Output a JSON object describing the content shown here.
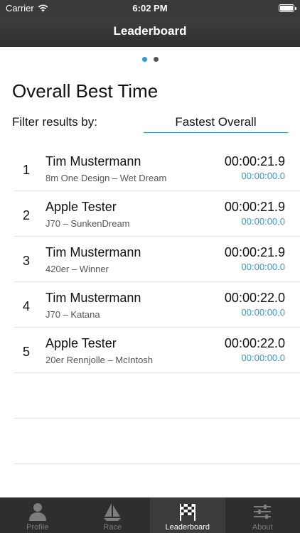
{
  "status": {
    "carrier": "Carrier",
    "time": "6:02 PM"
  },
  "nav": {
    "title": "Leaderboard"
  },
  "page": {
    "title": "Overall Best Time",
    "filter_label": "Filter results by:",
    "filter_value": "Fastest Overall"
  },
  "results": [
    {
      "rank": "1",
      "name": "Tim Mustermann",
      "boat": "8m One Design – Wet Dream",
      "time": "00:00:21.9",
      "sub": "00:00:00.0"
    },
    {
      "rank": "2",
      "name": "Apple Tester",
      "boat": "J70 – SunkenDream",
      "time": "00:00:21.9",
      "sub": "00:00:00.0"
    },
    {
      "rank": "3",
      "name": "Tim Mustermann",
      "boat": "420er – Winner",
      "time": "00:00:21.9",
      "sub": "00:00:00.0"
    },
    {
      "rank": "4",
      "name": "Tim Mustermann",
      "boat": "J70 – Katana",
      "time": "00:00:22.0",
      "sub": "00:00:00.0"
    },
    {
      "rank": "5",
      "name": "Apple Tester",
      "boat": "20er Rennjolle – McIntosh",
      "time": "00:00:22.0",
      "sub": "00:00:00.0"
    }
  ],
  "tabs": [
    {
      "label": "Profile",
      "icon": "person-icon"
    },
    {
      "label": "Race",
      "icon": "sailboat-icon"
    },
    {
      "label": "Leaderboard",
      "icon": "checkered-flag-icon"
    },
    {
      "label": "About",
      "icon": "sliders-icon"
    }
  ],
  "colors": {
    "accent": "#2f9ad6",
    "bar": "#2e2e2e"
  }
}
